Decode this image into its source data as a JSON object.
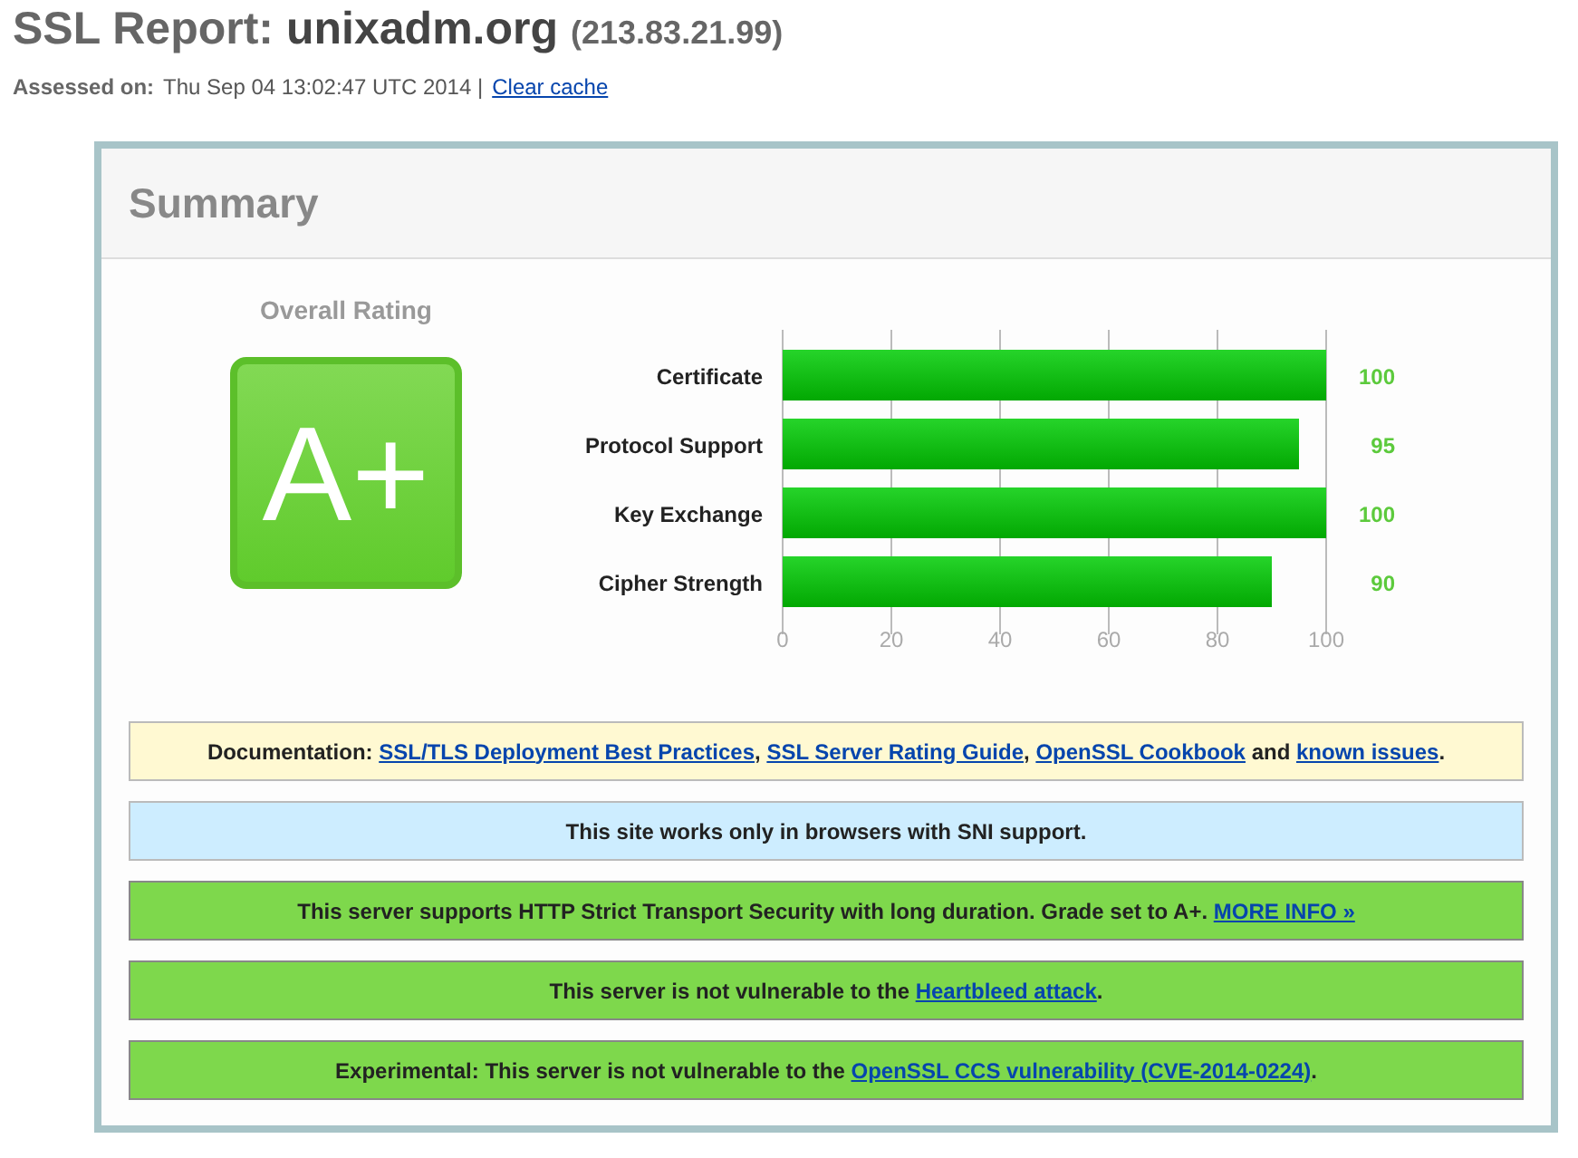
{
  "report": {
    "title": "SSL Report:",
    "host": "unixadm.org",
    "ip": "(213.83.21.99)",
    "assessed_label": "Assessed on:",
    "assessed_value": "Thu Sep 04 13:02:47 UTC 2014 |",
    "clear_cache": "Clear cache"
  },
  "summary": {
    "heading": "Summary",
    "rating_label": "Overall Rating",
    "grade": "A+",
    "chart_data": {
      "type": "bar",
      "orientation": "horizontal",
      "categories": [
        "Certificate",
        "Protocol Support",
        "Key Exchange",
        "Cipher Strength"
      ],
      "values": [
        100,
        95,
        100,
        90
      ],
      "xlim": [
        0,
        100
      ],
      "xticks": [
        0,
        20,
        40,
        60,
        80,
        100
      ],
      "grid": true,
      "data_labels": true
    },
    "notices": [
      {
        "kind": "doc",
        "parts": [
          {
            "text": "Documentation: ",
            "link": false
          },
          {
            "text": "SSL/TLS Deployment Best Practices",
            "link": true
          },
          {
            "text": ", ",
            "link": false
          },
          {
            "text": "SSL Server Rating Guide",
            "link": true
          },
          {
            "text": ", ",
            "link": false
          },
          {
            "text": "OpenSSL Cookbook",
            "link": true
          },
          {
            "text": " and ",
            "link": false
          },
          {
            "text": "known issues",
            "link": true
          },
          {
            "text": ".",
            "link": false
          }
        ]
      },
      {
        "kind": "info",
        "parts": [
          {
            "text": "This site works only in browsers with SNI support.",
            "link": false
          }
        ]
      },
      {
        "kind": "good",
        "parts": [
          {
            "text": "This server supports HTTP Strict Transport Security with long duration. Grade set to A+.  ",
            "link": false
          },
          {
            "text": "MORE INFO »",
            "link": true
          }
        ]
      },
      {
        "kind": "good",
        "parts": [
          {
            "text": "This server is not vulnerable to the ",
            "link": false
          },
          {
            "text": "Heartbleed attack",
            "link": true
          },
          {
            "text": ".",
            "link": false
          }
        ]
      },
      {
        "kind": "good",
        "parts": [
          {
            "text": "Experimental: This server is not vulnerable to the ",
            "link": false
          },
          {
            "text": "OpenSSL CCS vulnerability (CVE-2014-0224)",
            "link": true
          },
          {
            "text": ".",
            "link": false
          }
        ]
      }
    ]
  }
}
